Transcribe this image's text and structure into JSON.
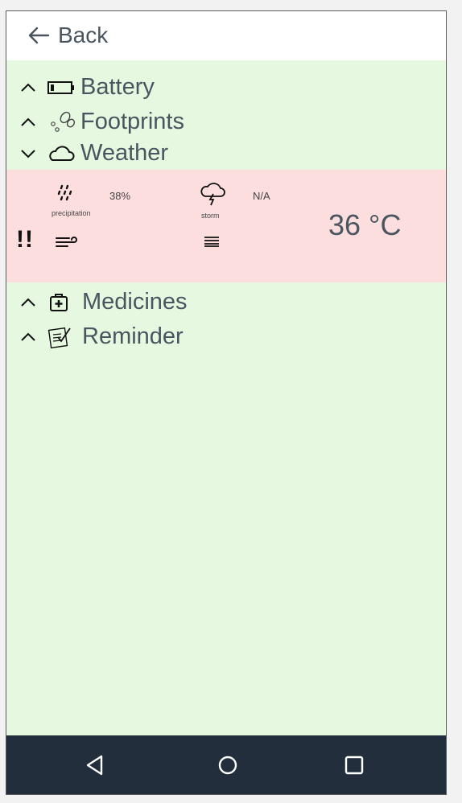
{
  "header": {
    "back_label": "Back"
  },
  "sections": {
    "battery": {
      "label": "Battery",
      "icon": "battery-icon"
    },
    "footprints": {
      "label": "Footprints",
      "icon": "footprints-icon"
    },
    "weather": {
      "label": "Weather",
      "icon": "cloud-icon",
      "expanded": true
    },
    "medicines": {
      "label": "Medicines",
      "icon": "medical-kit-icon"
    },
    "reminder": {
      "label": "Reminder",
      "icon": "checklist-icon"
    }
  },
  "weather": {
    "precipitation_label": "precipitation",
    "precipitation_value": "38%",
    "storm_label": "storm",
    "storm_value": "N/A",
    "alert_text": "!!",
    "temperature": "36 °C",
    "panel_color": "#fddede"
  },
  "colors": {
    "background": "#e6f9e0",
    "text": "#4a5560",
    "navbar": "#222e3b"
  },
  "navbar": {
    "back_icon": "nav-back-icon",
    "home_icon": "nav-home-icon",
    "recents_icon": "nav-recents-icon"
  }
}
